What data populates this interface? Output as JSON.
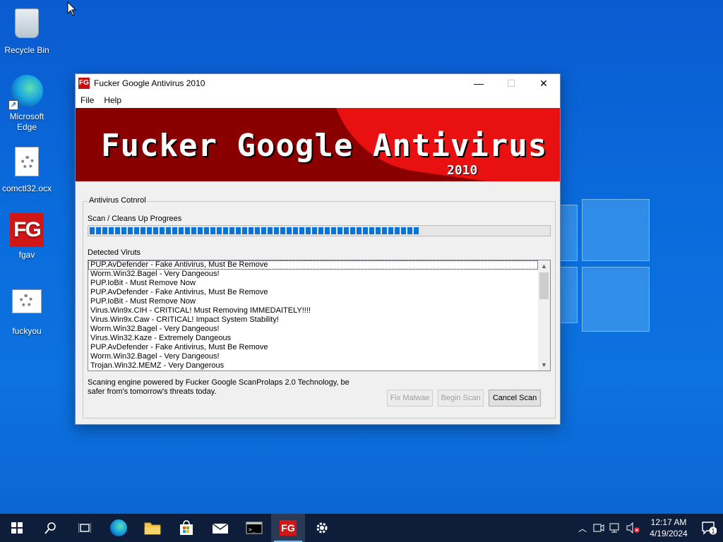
{
  "desktop": {
    "icons": [
      {
        "label": "Recycle Bin"
      },
      {
        "label": "Microsoft Edge"
      },
      {
        "label": "comctl32.ocx"
      },
      {
        "label": "fgav"
      },
      {
        "label": "fuckyou"
      }
    ],
    "fg_logo_text": "FG"
  },
  "window": {
    "title": "Fucker Google Antivirus 2010",
    "app_icon_text": "FG",
    "menu": [
      "File",
      "Help"
    ],
    "banner": {
      "title": "Fucker Google Antivirus",
      "year": "2010"
    },
    "group_label": "Antivirus Cotnrol",
    "progress_label": "Scan / Cleans Up Progrees",
    "progress_value": 0.72,
    "detected_label": "Detected Viruts",
    "detected": [
      "PUP.AvDefender - Fake Antivirus, Must Be Remove",
      "Worm.Win32.Bagel - Very Dangeous!",
      "PUP.IoBit - Must Remove Now",
      "PUP.AvDefender - Fake Antivirus, Must Be Remove",
      "PUP.IoBit - Must Remove Now",
      "Virus.Win9x.CIH - CRITICAL! Must Removing IMMEDAITELY!!!!",
      "Virus.Win9x.Caw - CRITICAL! Impact System Stability!",
      "Worm.Win32.Bagel - Very Dangeous!",
      "Virus.Win32.Kaze  - Extremely Dangeous",
      "PUP.AvDefender - Fake Antivirus, Must Be Remove",
      "Worm.Win32.Bagel - Very Dangeous!",
      "Trojan.Win32.MEMZ - Very Dangerous"
    ],
    "footer": "Scaning engine powered by Fucker Google ScanProlaps 2.0 Technology, be safer from's tomorrow's threats today.",
    "buttons": {
      "fix": "Fix Malwae",
      "begin": "Begin Scan",
      "cancel": "Cancel Scan"
    }
  },
  "taskbar": {
    "fg_text": "FG",
    "time": "12:17 AM",
    "date": "4/19/2024",
    "notification_count": "1"
  }
}
